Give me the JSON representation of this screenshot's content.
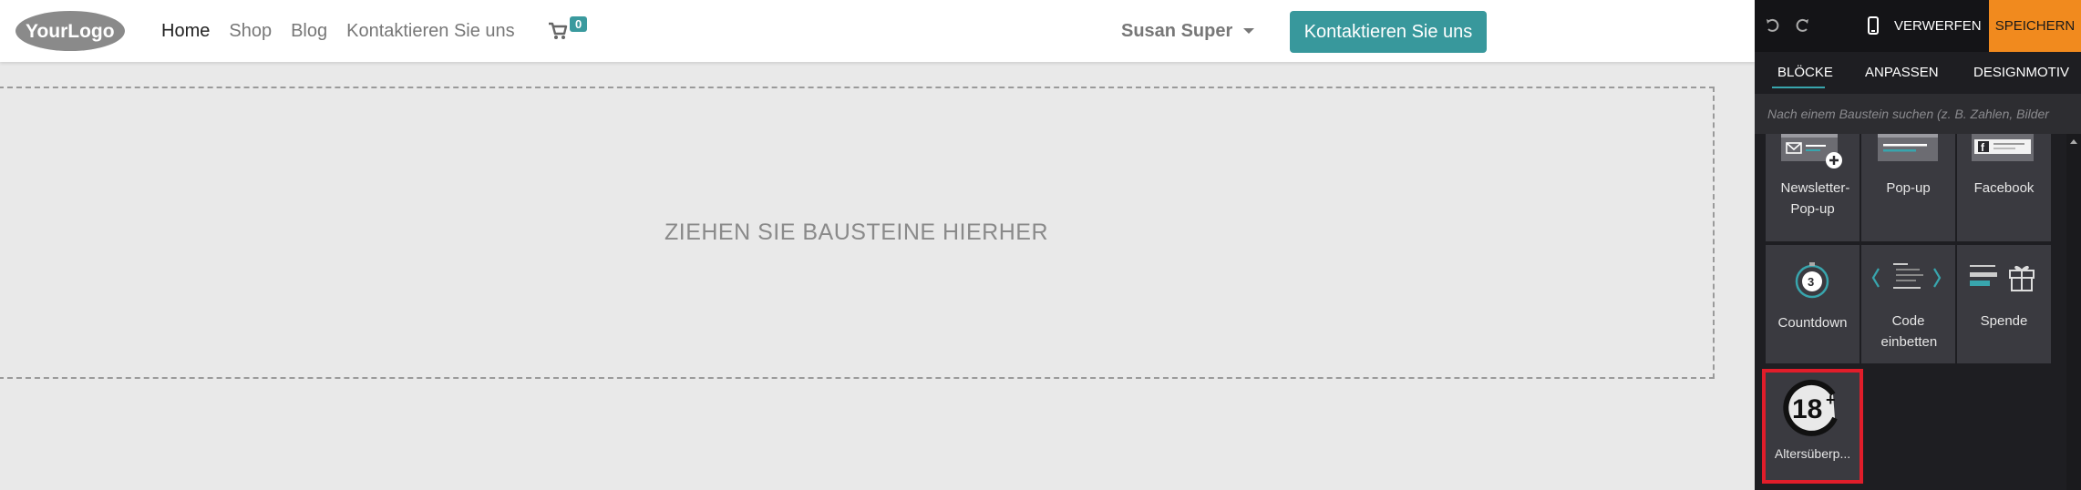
{
  "site": {
    "logo_text": "YourLogo",
    "nav": [
      "Home",
      "Shop",
      "Blog",
      "Kontaktieren Sie uns"
    ],
    "cart_count": "0",
    "user_name": "Susan Super",
    "cta_label": "Kontaktieren Sie uns",
    "dropzone_text": "ZIEHEN SIE BAUSTEINE HIERHER"
  },
  "editor": {
    "discard_label": "VERWERFEN",
    "save_label": "SPEICHERN",
    "tabs": [
      "BLÖCKE",
      "ANPASSEN",
      "DESIGNMOTIV"
    ],
    "search_placeholder": "Nach einem Baustein suchen (z. B. Zahlen, Bilder",
    "blocks": [
      "Newsletter-Pop-up",
      "Pop-up",
      "Facebook",
      "Countdown",
      "Code einbetten",
      "Spende",
      "Altersüberp..."
    ],
    "colors": {
      "accent": "#38989c",
      "save": "#f18a1e",
      "highlight": "#e11d2a"
    }
  }
}
